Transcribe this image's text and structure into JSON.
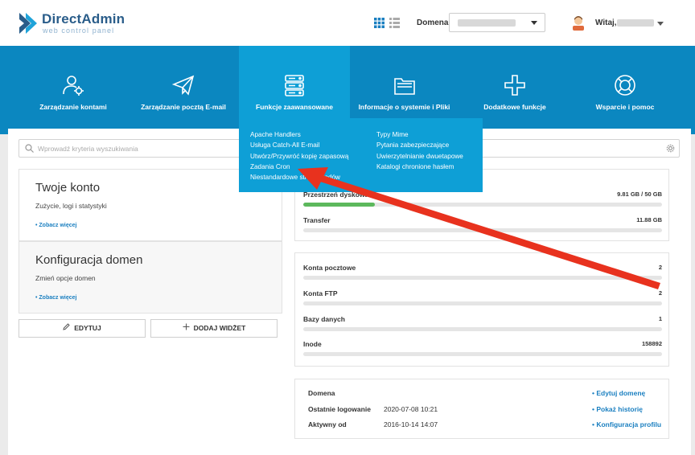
{
  "header": {
    "logo_title": "DirectAdmin",
    "logo_subtitle": "web control panel",
    "domain_label": "Domena",
    "user_greeting": "Witaj,"
  },
  "nav": {
    "items": [
      {
        "label": "Zarządzanie kontami",
        "icon": "users-gear-icon"
      },
      {
        "label": "Zarządzanie pocztą E-mail",
        "icon": "paper-plane-icon"
      },
      {
        "label": "Funkcje zaawansowane",
        "icon": "server-icon"
      },
      {
        "label": "Informacje o systemie i Pliki",
        "icon": "folder-icon"
      },
      {
        "label": "Dodatkowe funkcje",
        "icon": "plus-icon"
      },
      {
        "label": "Wsparcie i pomoc",
        "icon": "lifebuoy-icon"
      }
    ]
  },
  "dropdown": {
    "col1": [
      "Apache Handlers",
      "Usługa Catch-All E-mail",
      "Utwórz/Przywróć kopię zapasową",
      "Zadania Cron",
      "Niestandardowe strony błędów"
    ],
    "col2": [
      "Typy Mime",
      "Pytania zabezpieczające",
      "Uwierzytelnianie dwuetapowe",
      "Katalogi chronione hasłem"
    ]
  },
  "search": {
    "placeholder": "Wprowadź kryteria wyszukiwania"
  },
  "widgets": {
    "account": {
      "title": "Twoje konto",
      "desc": "Zużycie, logi i statystyki",
      "more": "• Zobacz więcej"
    },
    "domains": {
      "title": "Konfiguracja domen",
      "desc": "Zmień opcje domen",
      "more": "• Zobacz więcej"
    }
  },
  "buttons": {
    "edit": "EDYTUJ",
    "add_widget": "DODAJ WIDŻET"
  },
  "stats1": [
    {
      "name": "Przestrzeń dyskowa",
      "value": "9.81 GB / 50 GB",
      "fill_pct": 20
    },
    {
      "name": "Transfer",
      "value": "11.88 GB",
      "fill_pct": 0
    }
  ],
  "stats2": [
    {
      "name": "Konta pocztowe",
      "value": "2"
    },
    {
      "name": "Konta FTP",
      "value": "2"
    },
    {
      "name": "Bazy danych",
      "value": "1"
    },
    {
      "name": "Inode",
      "value": "158892"
    }
  ],
  "info": [
    {
      "key": "Domena",
      "value": "",
      "link": "• Edytuj domenę"
    },
    {
      "key": "Ostatnie logowanie",
      "value": "2020-07-08 10:21",
      "link": "• Pokaż historię"
    },
    {
      "key": "Aktywny od",
      "value": "2016-10-14 14:07",
      "link": "• Konfiguracja profilu"
    }
  ],
  "colors": {
    "brand_blue": "#0b87c0",
    "active_blue": "#0e9fd6",
    "link_blue": "#1a7fc0",
    "progress_green": "#5cb85c",
    "annotation_red": "#e8321e"
  }
}
